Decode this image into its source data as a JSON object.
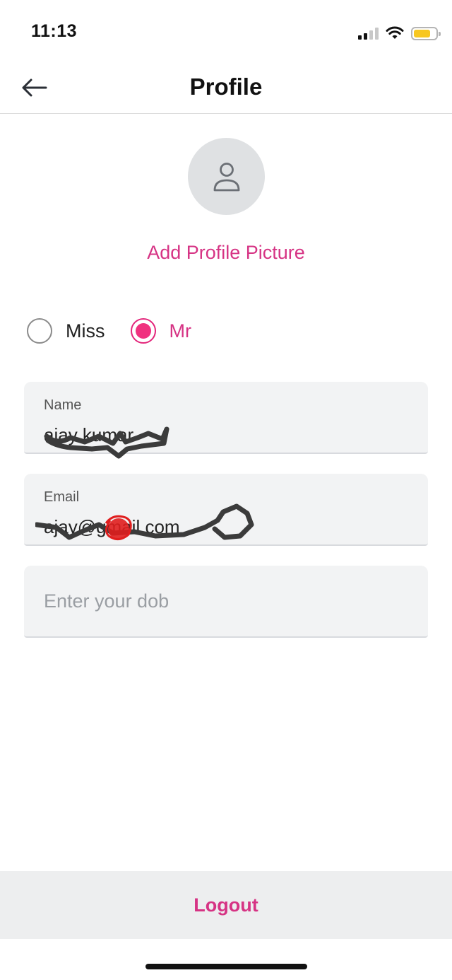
{
  "status_bar": {
    "time": "11:13",
    "icons": [
      "cellular-signal-icon",
      "wifi-icon",
      "battery-icon"
    ],
    "battery_color": "#f7c720"
  },
  "header": {
    "title": "Profile",
    "back_icon": "back-arrow-icon"
  },
  "profile": {
    "avatar_icon": "user-icon",
    "add_picture_label": "Add Profile Picture"
  },
  "title_options": [
    {
      "label": "Miss",
      "selected": false
    },
    {
      "label": "Mr",
      "selected": true
    }
  ],
  "form": {
    "name": {
      "label": "Name",
      "value": "ajay kumar"
    },
    "email": {
      "label": "Email",
      "value": "ajay@gmail.com"
    },
    "dob": {
      "placeholder": "Enter your dob",
      "value": ""
    }
  },
  "footer": {
    "logout_label": "Logout"
  },
  "colors": {
    "accent": "#d63384",
    "radio_fill": "#f0317f",
    "field_bg": "#f2f3f4",
    "logout_bg": "#edeeef"
  }
}
